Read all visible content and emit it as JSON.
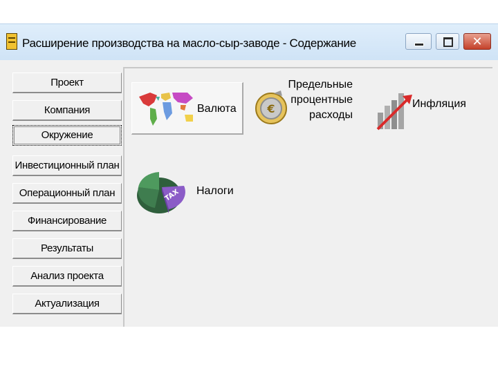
{
  "window": {
    "title": "Расширение производства на масло-сыр-заводе - Содержание",
    "icons": [
      "app-icon",
      "minimize-icon",
      "maximize-icon",
      "close-icon"
    ]
  },
  "nav": {
    "items": [
      {
        "label": "Проект"
      },
      {
        "label": "Компания"
      },
      {
        "label": "Окружение",
        "active": true
      },
      {
        "label": "Инвестиционный план"
      },
      {
        "label": "Операционный план"
      },
      {
        "label": "Финансирование"
      },
      {
        "label": "Результаты"
      },
      {
        "label": "Анализ проекта"
      },
      {
        "label": "Актуализация"
      }
    ]
  },
  "panel": {
    "tiles": [
      {
        "label": "Валюта",
        "icon": "world-map-icon",
        "selected": true
      },
      {
        "label_lines": [
          "Предельные",
          "процентные",
          "расходы"
        ],
        "icon": "euro-coin-icon"
      },
      {
        "label": "Инфляция",
        "icon": "rising-chart-arrow-icon"
      },
      {
        "label": "Налоги",
        "icon": "tax-pie-chart-icon",
        "icon_text": "TAX"
      }
    ]
  },
  "colors": {
    "titlebar": "#cfe3f6",
    "window_bg": "#f0f0f0",
    "close_button": "#c4412a",
    "tax_pie_green": "#3f7d4f",
    "tax_pie_purple": "#8b5cc7"
  }
}
